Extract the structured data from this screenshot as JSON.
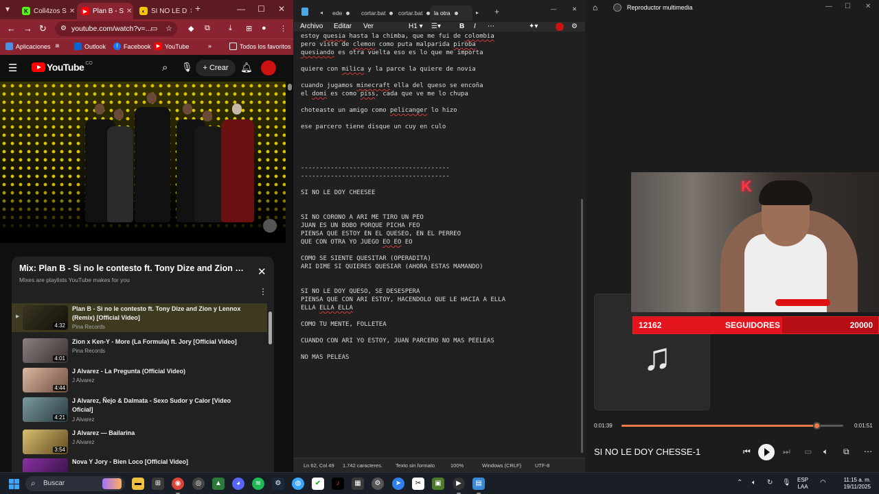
{
  "browser": {
    "tabs": [
      {
        "label": "Coll4zos S",
        "fav_color": "#53fc18",
        "fav_text": "K"
      },
      {
        "label": "Plan B - S",
        "fav_color": "#ff0000",
        "fav_text": "▶"
      },
      {
        "label": "SI NO LE D",
        "fav_color": "#f6c400",
        "fav_text": "◐"
      }
    ],
    "url": "youtube.com/watch?v=...",
    "bookmarks": [
      "Aplicaciones",
      "Outlook",
      "Facebook",
      "YouTube",
      "Todos los favoritos"
    ],
    "accent": "#8a2430"
  },
  "youtube": {
    "logo_text": "YouTube",
    "region": "CO",
    "create_label": "Crear",
    "playlist": {
      "title": "Mix: Plan B - Si no le contesto ft. Tony Dize and Zion y...",
      "subtitle": "Mixes are playlists YouTube makes for you",
      "items": [
        {
          "title": "Plan B - Si no le contesto ft. Tony Dize and Zion y Lennox (Remix) [Official Video]",
          "channel": "Pina Records",
          "duration": "4:32",
          "active": true,
          "thumb": "#3a3520"
        },
        {
          "title": "Zion x Ken-Y - More (La Formula) ft. Jory [Official Video]",
          "channel": "Pina Records",
          "duration": "4:01",
          "active": false,
          "thumb": "#6a6060"
        },
        {
          "title": "J Alvarez - La Pregunta (Official Video)",
          "channel": "J Alvarez",
          "duration": "4:44",
          "active": false,
          "thumb": "#b08a70"
        },
        {
          "title": "J Alvarez, Ñejo & Dalmata - Sexo Sudor y Calor [Video Oficial]",
          "channel": "J Alvarez",
          "duration": "4:21",
          "active": false,
          "thumb": "#4a6a70"
        },
        {
          "title": "J Alvarez — Bailarina",
          "channel": "J Alvarez",
          "duration": "3:54",
          "active": false,
          "thumb": "#a08a40"
        },
        {
          "title": "Nova Y Jory - Bien Loco [Official Video]",
          "channel": "",
          "duration": "",
          "active": false,
          "thumb": "#5a2070"
        }
      ]
    }
  },
  "notepad": {
    "tabs": [
      "ede",
      "cortar.bat",
      "cortar.bat",
      "la otra"
    ],
    "menu": [
      "Archivo",
      "Editar",
      "Ver"
    ],
    "heading_select": "H1",
    "lines": [
      [
        {
          "t": "estoy "
        },
        {
          "t": "quesia",
          "sq": true
        },
        {
          "t": " hasta la chimba, que me fui de "
        },
        {
          "t": "colombia",
          "sq": true
        }
      ],
      [
        {
          "t": "pero viste de "
        },
        {
          "t": "clemon",
          "sq": true
        },
        {
          "t": " como puta malparida "
        },
        {
          "t": "piroba",
          "sq": true
        }
      ],
      [
        {
          "t": "quesiando",
          "sq": true
        },
        {
          "t": " es otra vuelta eso es lo que me importa"
        }
      ],
      [],
      [
        {
          "t": "quiere con "
        },
        {
          "t": "milica",
          "sq": true
        },
        {
          "t": " y la parce la quiere de novia"
        }
      ],
      [],
      [
        {
          "t": "cuando jugamos "
        },
        {
          "t": "minecraft",
          "sq": true
        },
        {
          "t": " ella del queso se encoña"
        }
      ],
      [
        {
          "t": "el "
        },
        {
          "t": "domi",
          "sq": true
        },
        {
          "t": " es como "
        },
        {
          "t": "piss",
          "sq": true
        },
        {
          "t": ", cada que ve me lo chupa"
        }
      ],
      [],
      [
        {
          "t": "choteaste un amigo como "
        },
        {
          "t": "pelicanger",
          "sq": true
        },
        {
          "t": " lo hizo"
        }
      ],
      [],
      [
        {
          "t": "ese parcero tiene disque un cuy en culo"
        }
      ],
      [],
      [],
      [],
      [],
      [
        {
          "t": "----------------------------------------"
        }
      ],
      [
        {
          "t": "----------------------------------------"
        }
      ],
      [],
      [
        {
          "t": "SI NO LE DOY CHEESEE"
        }
      ],
      [],
      [],
      [
        {
          "t": "SI NO CORONO A ARI ME TIRO UN PEO"
        }
      ],
      [
        {
          "t": "JUAN ES UN BOBO PORQUE PICHA FEO"
        }
      ],
      [
        {
          "t": "PIENSA QUE ESTOY EN EL QUESEO, EN EL PERREO"
        }
      ],
      [
        {
          "t": "QUE CON OTRA YO JUEGO "
        },
        {
          "t": "EO EO",
          "sq": true
        },
        {
          "t": " EO"
        }
      ],
      [],
      [
        {
          "t": "COMO SE SIENTE QUESITAR (OPERADITA)"
        }
      ],
      [
        {
          "t": "ARI DIME SI QUIERES QUESIAR (AHORA ESTAS MAMANDO)"
        }
      ],
      [],
      [],
      [
        {
          "t": "SI NO LE DOY QUESO, SE DESESPERA"
        }
      ],
      [
        {
          "t": "PIENSA QUE CON ARI ESTOY, HACENDOLO QUE LE HACIA A ELLA"
        }
      ],
      [
        {
          "t": "ELLA "
        },
        {
          "t": "ELLA ELLA",
          "sq": true
        }
      ],
      [],
      [
        {
          "t": "COMO TU MENTE, FOLLETEA"
        }
      ],
      [],
      [
        {
          "t": "CUANDO CON ARI YO ESTOY, JUAN PARCERO NO MAS PEELEAS"
        }
      ],
      [],
      [
        {
          "t": "NO MAS PELEAS"
        }
      ]
    ],
    "status": {
      "position": "Ln 62, Col 49",
      "chars": "1.742 caracteres.",
      "format": "Texto sin formato",
      "zoom": "100%",
      "eol": "Windows (CRLF)",
      "encoding": "UTF-8"
    }
  },
  "media": {
    "app_title": "Reproductor multimedia",
    "overlay": {
      "current": "12162",
      "label": "SEGUIDORES",
      "goal": "20000",
      "sign_text": "K"
    },
    "progress": {
      "elapsed": "0:01:39",
      "total": "0:01:51",
      "fraction": 0.88
    },
    "song_title": "SI NO LE DOY CHESSE-1"
  },
  "taskbar": {
    "search_label": "Buscar",
    "lang_line1": "ESP",
    "lang_line2": "LAA",
    "time": "11:15 a. m.",
    "date": "19/11/2025"
  }
}
